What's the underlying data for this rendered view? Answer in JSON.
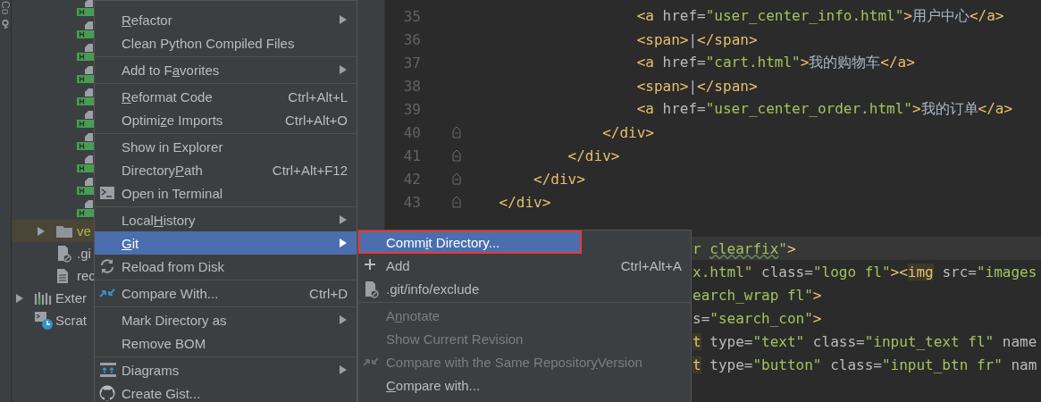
{
  "tool_strip": {
    "label": "Co"
  },
  "tree": {
    "items": [
      {
        "children": [
          {
            "children": [
              {
                "kind": "html-file"
              },
              {
                "kind": "html-file"
              },
              {
                "kind": "html-file"
              },
              {
                "kind": "html-file"
              },
              {
                "kind": "html-file"
              },
              {
                "kind": "html-file"
              },
              {
                "kind": "html-file"
              },
              {
                "kind": "html-file"
              },
              {
                "kind": "html-file"
              },
              {
                "kind": "html-file"
              }
            ]
          },
          {
            "kind": "folder",
            "label": "ve",
            "expanded": false,
            "selected": true
          },
          {
            "kind": "ignored-file",
            "label": ".gi"
          },
          {
            "kind": "text-file",
            "label": "rec"
          }
        ]
      },
      {
        "kind": "library",
        "label": "Exter",
        "expanded": false
      },
      {
        "kind": "scratches",
        "label": "Scrat"
      }
    ]
  },
  "editor": {
    "lines": [
      {
        "number": "35",
        "fold": false,
        "current": false,
        "tail": false,
        "code": [
          {
            "kind": "tag",
            "text": "                    <a"
          },
          {
            "kind": "attr",
            "text": " href="
          },
          {
            "kind": "value",
            "text": "\"user_center_info.html\""
          },
          {
            "kind": "tag",
            "text": ">"
          },
          {
            "kind": "text",
            "text": "用户中心"
          },
          {
            "kind": "tag",
            "text": "</a>"
          }
        ]
      },
      {
        "number": "36",
        "fold": false,
        "current": false,
        "tail": false,
        "code": [
          {
            "kind": "tag",
            "text": "                    <span>"
          },
          {
            "kind": "text",
            "text": "|"
          },
          {
            "kind": "tag",
            "text": "</span>"
          }
        ]
      },
      {
        "number": "37",
        "fold": false,
        "current": false,
        "tail": false,
        "code": [
          {
            "kind": "tag",
            "text": "                    <a"
          },
          {
            "kind": "attr",
            "text": " href="
          },
          {
            "kind": "value",
            "text": "\"cart.html\""
          },
          {
            "kind": "tag",
            "text": ">"
          },
          {
            "kind": "text",
            "text": "我的购物车"
          },
          {
            "kind": "tag",
            "text": "</a>"
          }
        ]
      },
      {
        "number": "38",
        "fold": false,
        "current": false,
        "tail": false,
        "code": [
          {
            "kind": "tag",
            "text": "                    <span>"
          },
          {
            "kind": "text",
            "text": "|"
          },
          {
            "kind": "tag",
            "text": "</span>"
          }
        ]
      },
      {
        "number": "39",
        "fold": false,
        "current": false,
        "tail": false,
        "code": [
          {
            "kind": "tag",
            "text": "                    <a"
          },
          {
            "kind": "attr",
            "text": " href="
          },
          {
            "kind": "value",
            "text": "\"user_center_order.html\""
          },
          {
            "kind": "tag",
            "text": ">"
          },
          {
            "kind": "text",
            "text": "我的订单"
          },
          {
            "kind": "tag",
            "text": "</a>"
          }
        ]
      },
      {
        "number": "40",
        "fold": true,
        "current": false,
        "tail": false,
        "code": [
          {
            "kind": "tag",
            "text": "                </div>"
          }
        ]
      },
      {
        "number": "41",
        "fold": true,
        "current": false,
        "tail": false,
        "code": [
          {
            "kind": "tag",
            "text": "            </div>"
          }
        ]
      },
      {
        "number": "42",
        "fold": true,
        "current": false,
        "tail": false,
        "code": [
          {
            "kind": "tag",
            "text": "        </div>"
          }
        ]
      },
      {
        "number": "43",
        "fold": true,
        "current": false,
        "tail": false,
        "code": [
          {
            "kind": "tag",
            "text": "    </div>"
          }
        ]
      },
      {
        "fold": false,
        "current": false
      },
      {
        "fold": false,
        "current": true,
        "tail": true,
        "code": [
          {
            "kind": "value",
            "text": "r "
          },
          {
            "kind": "flagged",
            "text": "clearfix"
          },
          {
            "kind": "value",
            "text": "\""
          },
          {
            "kind": "tag",
            "text": ">"
          }
        ]
      },
      {
        "fold": false,
        "current": false,
        "tail": true,
        "code": [
          {
            "kind": "value",
            "text": "x.html\""
          },
          {
            "kind": "attr",
            "text": " class="
          },
          {
            "kind": "value",
            "text": "\"logo fl\""
          },
          {
            "kind": "tag",
            "text": "><"
          },
          {
            "kind": "match",
            "text": "img"
          },
          {
            "kind": "attr",
            "text": " src="
          },
          {
            "kind": "value",
            "text": "\"images"
          }
        ]
      },
      {
        "fold": false,
        "current": false,
        "tail": true,
        "code": [
          {
            "kind": "value",
            "text": "earch_wrap fl\""
          },
          {
            "kind": "tag",
            "text": ">"
          }
        ]
      },
      {
        "fold": false,
        "current": false,
        "tail": true,
        "code": [
          {
            "kind": "attr",
            "text": "s="
          },
          {
            "kind": "value",
            "text": "\"search_con\""
          },
          {
            "kind": "tag",
            "text": ">"
          }
        ]
      },
      {
        "fold": false,
        "current": false,
        "tail": true,
        "code": [
          {
            "kind": "match",
            "text": "t"
          },
          {
            "kind": "attr",
            "text": " type="
          },
          {
            "kind": "value",
            "text": "\"text\""
          },
          {
            "kind": "attr",
            "text": " class="
          },
          {
            "kind": "value",
            "text": "\"input_text fl\""
          },
          {
            "kind": "attr",
            "text": " name"
          }
        ]
      },
      {
        "fold": false,
        "current": false,
        "tail": true,
        "code": [
          {
            "kind": "match",
            "text": "t"
          },
          {
            "kind": "attr",
            "text": " type="
          },
          {
            "kind": "value",
            "text": "\"button\""
          },
          {
            "kind": "attr",
            "text": " class="
          },
          {
            "kind": "value",
            "text": "\"input_btn fr\""
          },
          {
            "kind": "attr",
            "text": " nam"
          }
        ]
      }
    ]
  },
  "context_menu": {
    "items": [
      {
        "kind": "item",
        "label": {
          "key": "R",
          "rest": "efactor"
        },
        "submenu": true,
        "selected": false
      },
      {
        "kind": "item",
        "label": "Clean Python Compiled Files",
        "submenu": false,
        "selected": false
      },
      {
        "kind": "separator"
      },
      {
        "kind": "item",
        "label": {
          "pre": "Add to F",
          "key": "a",
          "rest": "vorites"
        },
        "submenu": true,
        "selected": false
      },
      {
        "kind": "separator"
      },
      {
        "kind": "item",
        "label": {
          "key": "R",
          "rest": "eformat Code"
        },
        "shortcut": "Ctrl+Alt+L",
        "submenu": false,
        "selected": false
      },
      {
        "kind": "item",
        "label": {
          "pre": "Optimi",
          "key": "z",
          "rest": "e Imports"
        },
        "shortcut": "Ctrl+Alt+O",
        "submenu": false,
        "selected": false
      },
      {
        "kind": "separator"
      },
      {
        "kind": "item",
        "label": "Show in Explorer",
        "submenu": false,
        "selected": false
      },
      {
        "kind": "item",
        "label": {
          "pre": "Directory ",
          "key": "P",
          "rest": "ath"
        },
        "shortcut": "Ctrl+Alt+F12",
        "submenu": false,
        "selected": false
      },
      {
        "kind": "terminal",
        "label": "Open in Terminal",
        "submenu": false,
        "selected": false
      },
      {
        "kind": "separator"
      },
      {
        "kind": "item",
        "label": {
          "pre": "Local ",
          "key": "H",
          "rest": "istory"
        },
        "submenu": true,
        "selected": false
      },
      {
        "kind": "item",
        "label": {
          "key": "G",
          "rest": "it"
        },
        "submenu": true,
        "selected": true
      },
      {
        "kind": "reload",
        "label": "Reload from Disk",
        "submenu": false,
        "selected": false
      },
      {
        "kind": "separator"
      },
      {
        "kind": "compare",
        "label": "Compare With...",
        "shortcut": "Ctrl+D",
        "submenu": false,
        "selected": false
      },
      {
        "kind": "separator"
      },
      {
        "kind": "item",
        "label": "Mark Directory as",
        "submenu": true,
        "selected": false
      },
      {
        "kind": "item",
        "label": "Remove BOM",
        "submenu": false,
        "selected": false
      },
      {
        "kind": "separator"
      },
      {
        "kind": "diagrams",
        "label": "Diagrams",
        "submenu": true,
        "selected": false
      },
      {
        "kind": "gist",
        "label": "Create Gist...",
        "submenu": false,
        "selected": false
      }
    ]
  },
  "git_submenu": {
    "items": [
      {
        "kind": "item",
        "label": {
          "pre": "Comm",
          "key": "i",
          "rest": "t Directory..."
        },
        "selected": true,
        "outlined": true,
        "disabled": false
      },
      {
        "kind": "add",
        "label": "Add",
        "shortcut": "Ctrl+Alt+A",
        "selected": false,
        "outlined": false,
        "disabled": false
      },
      {
        "kind": "git-file",
        "label": ".git/info/exclude",
        "selected": false,
        "outlined": false,
        "disabled": false
      },
      {
        "kind": "separator"
      },
      {
        "kind": "item",
        "label": {
          "pre": "A",
          "key": "n",
          "rest": "notate"
        },
        "selected": false,
        "outlined": false,
        "disabled": true
      },
      {
        "kind": "item",
        "label": "Show Current Revision",
        "selected": false,
        "outlined": false,
        "disabled": true
      },
      {
        "kind": "compare",
        "label": {
          "pre": "Compare with the Same Repositor",
          "key": "y",
          "rest": " Version"
        },
        "selected": false,
        "outlined": false,
        "disabled": true
      },
      {
        "kind": "item",
        "label": {
          "key": "C",
          "rest": "ompare with..."
        },
        "selected": false,
        "outlined": false,
        "disabled": false
      }
    ]
  }
}
